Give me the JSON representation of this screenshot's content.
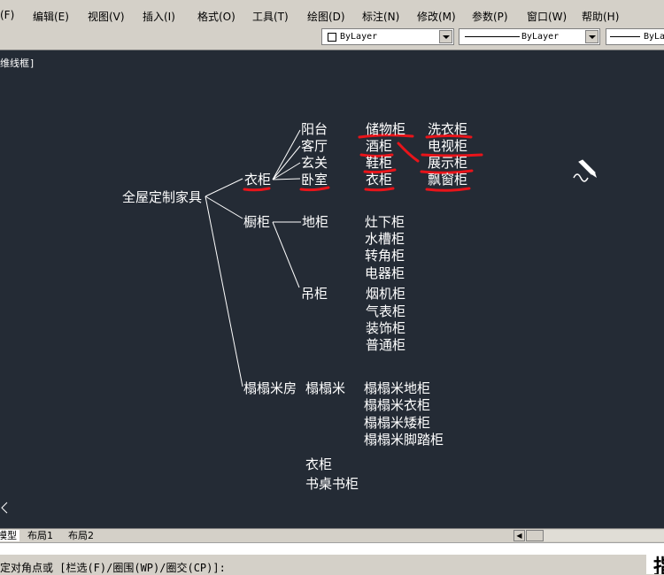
{
  "menu": [
    {
      "id": "file",
      "label": "(F)"
    },
    {
      "id": "edit",
      "label": "编辑(E)"
    },
    {
      "id": "view",
      "label": "视图(V)"
    },
    {
      "id": "insert",
      "label": "插入(I)"
    },
    {
      "id": "format",
      "label": "格式(O)"
    },
    {
      "id": "tools",
      "label": "工具(T)"
    },
    {
      "id": "draw",
      "label": "绘图(D)"
    },
    {
      "id": "dimension",
      "label": "标注(N)"
    },
    {
      "id": "modify",
      "label": "修改(M)"
    },
    {
      "id": "parameters",
      "label": "参数(P)"
    },
    {
      "id": "window",
      "label": "窗口(W)"
    },
    {
      "id": "help",
      "label": "帮助(H)"
    }
  ],
  "toolbar": {
    "color": "ByLayer",
    "linetype": "ByLayer",
    "lineweight": "ByLa"
  },
  "viewport_label": "维线框]",
  "drawing": {
    "root": "全屋定制家具",
    "wardrobe": "衣柜",
    "wardrobe_rooms": [
      "阳台",
      "客厅",
      "玄关",
      "卧室"
    ],
    "wardrobe_col1": [
      "储物柜",
      "酒柜",
      "鞋柜",
      "衣柜"
    ],
    "wardrobe_col2": [
      "洗衣柜",
      "电视柜",
      "展示柜",
      "飘窗柜"
    ],
    "cabinet": "橱柜",
    "base_cabinet": "地柜",
    "base_items": [
      "灶下柜",
      "水槽柜",
      "转角柜",
      "电器柜"
    ],
    "wall_cabinet": "吊柜",
    "wall_items": [
      "烟机柜",
      "气表柜",
      "装饰柜",
      "普通柜"
    ],
    "tatami_room": "榻榻米房",
    "tatami": "榻榻米",
    "tatami_items": [
      "榻榻米地柜",
      "榻榻米衣柜",
      "榻榻米矮柜",
      "榻榻米脚踏柜"
    ],
    "extra_items": [
      "衣柜",
      "书桌书柜"
    ]
  },
  "tabs": [
    {
      "id": "model",
      "label": "模型",
      "active": true
    },
    {
      "id": "layout1",
      "label": "布局1",
      "active": false
    },
    {
      "id": "layout2",
      "label": "布局2",
      "active": false
    }
  ],
  "command": {
    "prompt": "定对角点或 [栏选(F)/圈围(WP)/圈交(CP)]:",
    "input_glyph": "指"
  },
  "colors": {
    "canvas_bg": "#242b35",
    "drawing_text": "#ffffff",
    "markup_red": "#e8141a"
  }
}
